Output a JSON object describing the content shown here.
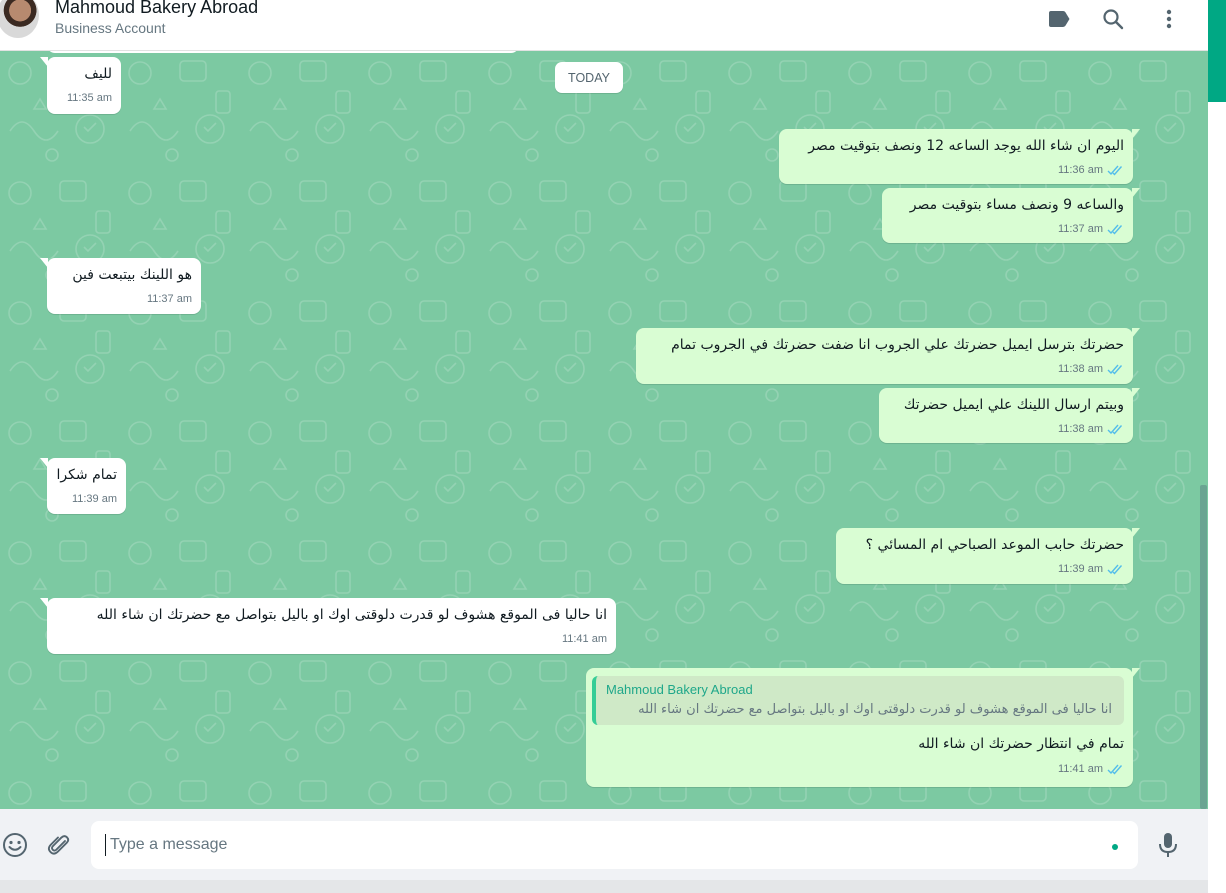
{
  "header": {
    "title": "Mahmoud Bakery Abroad",
    "subtitle": "Business Account",
    "icons": [
      "label-icon",
      "search-icon",
      "menu-icon"
    ]
  },
  "chat": {
    "date_chip": "TODAY",
    "messages": [
      {
        "dir": "in",
        "text": "لليف",
        "time": "11:35 am"
      },
      {
        "dir": "out",
        "text": "اليوم ان شاء الله يوجد الساعه 12 ونصف بتوقيت مصر",
        "time": "11:36 am",
        "status": "read"
      },
      {
        "dir": "out",
        "text": "والساعه 9 ونصف مساء بتوقيت مصر",
        "time": "11:37 am",
        "status": "read"
      },
      {
        "dir": "in",
        "text": "هو اللينك بيتبعت فين",
        "time": "11:37 am"
      },
      {
        "dir": "out",
        "text": "حضرتك بترسل ايميل حضرتك علي الجروب انا ضفت حضرتك في الجروب تمام",
        "time": "11:38 am",
        "status": "read"
      },
      {
        "dir": "out",
        "text": "وبيتم ارسال اللينك علي ايميل حضرتك",
        "time": "11:38 am",
        "status": "read"
      },
      {
        "dir": "in",
        "text": "تمام شكرا",
        "time": "11:39 am"
      },
      {
        "dir": "out",
        "text": "حضرتك حابب الموعد الصباحي ام المسائي ؟",
        "time": "11:39 am",
        "status": "read"
      },
      {
        "dir": "in",
        "text": "انا حاليا فى الموقع هشوف لو قدرت دلوقتى اوك او باليل بتواصل مع حضرتك ان شاء الله",
        "time": "11:41 am"
      },
      {
        "dir": "out",
        "text": "تمام في انتظار حضرتك ان شاء الله",
        "time": "11:41 am",
        "status": "read",
        "quote": {
          "name": "Mahmoud Bakery Abroad",
          "text": "انا حاليا فى الموقع هشوف لو قدرت دلوقتى اوك او باليل بتواصل مع حضرتك ان شاء الله"
        }
      }
    ]
  },
  "composer": {
    "placeholder": "Type a message",
    "value": "",
    "icons": [
      "emoji-icon",
      "attach-icon",
      "mic-icon"
    ]
  },
  "colors": {
    "chat_bg": "#7cc9a2",
    "incoming": "#ffffff",
    "outgoing": "#d9fdd3",
    "read_ticks": "#53bdeb",
    "accent": "#00a884"
  }
}
